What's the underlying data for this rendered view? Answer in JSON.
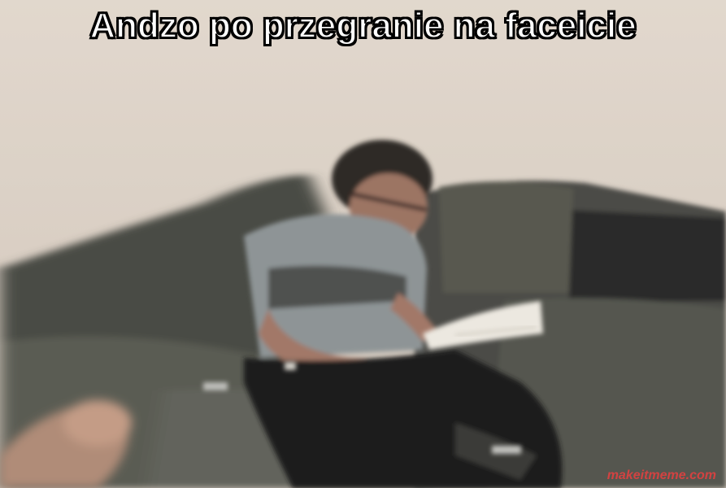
{
  "caption": {
    "text": "Andzo po przegranie na faceicie"
  },
  "watermark": {
    "text": "makeitmeme.com",
    "color": "#e04040"
  },
  "photo": {
    "colors": {
      "wall": "#ddd3c7",
      "sofa": "#4d4e48",
      "sofa_dark": "#2a2a28",
      "shirt": "#8e9496",
      "skin": "#a27868",
      "hair": "#2e2a26",
      "paper": "#ece8e0"
    }
  }
}
